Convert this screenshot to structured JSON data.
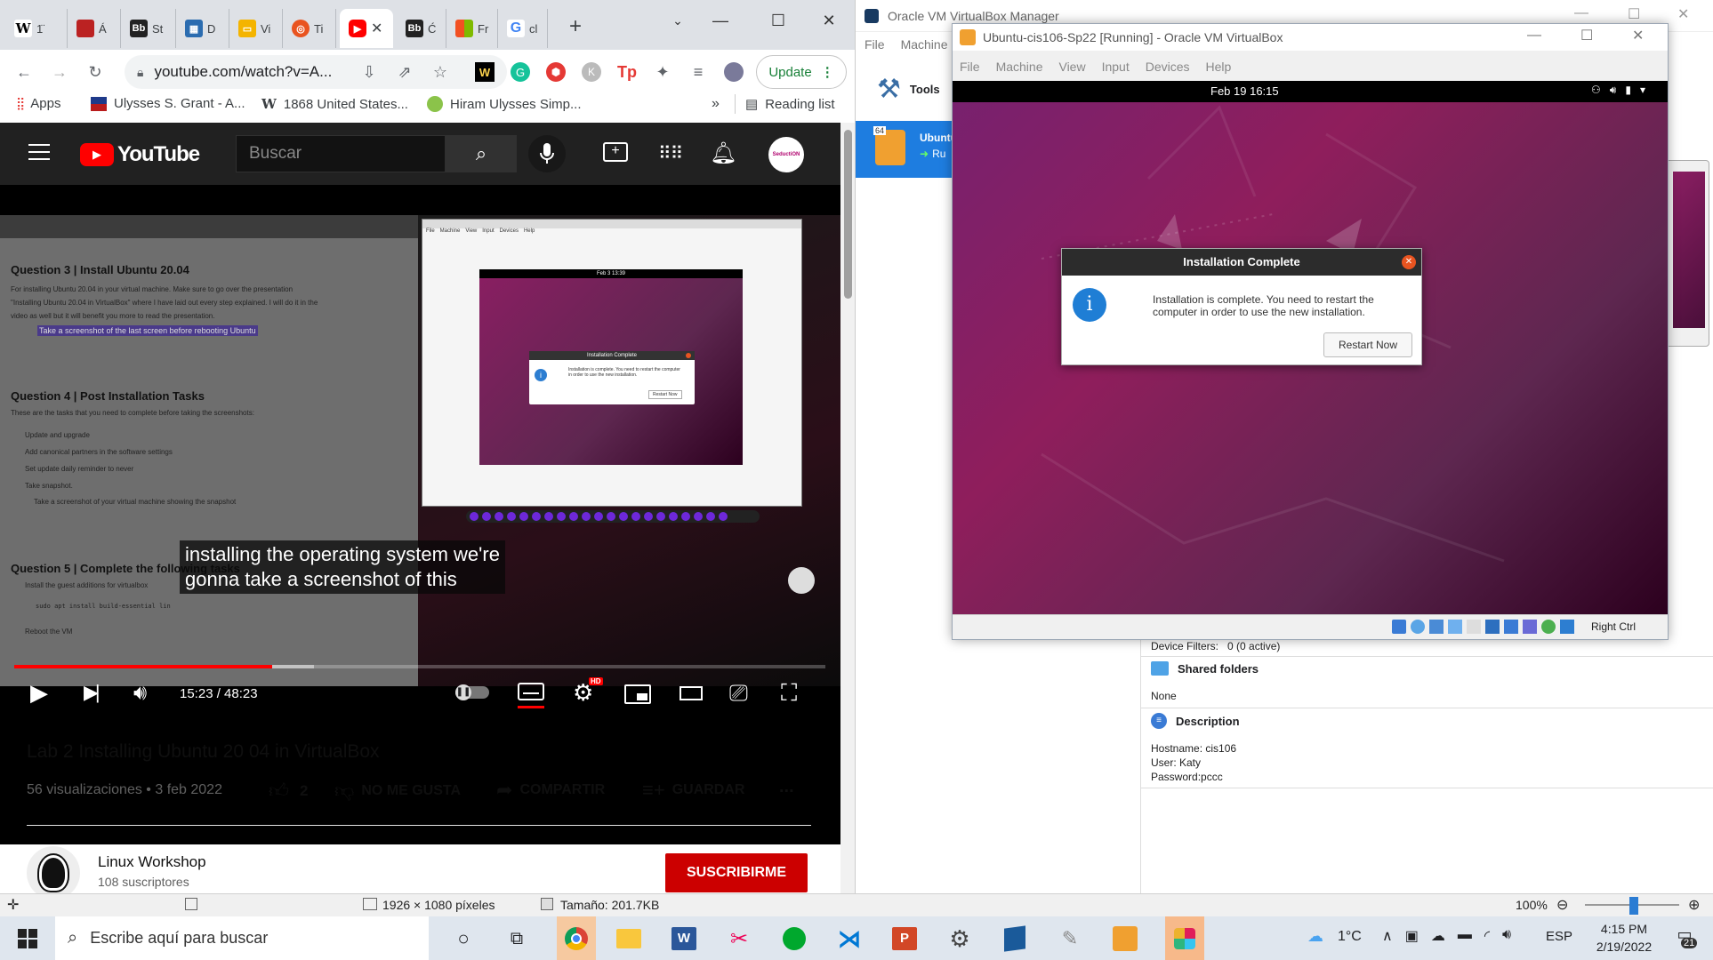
{
  "chrome": {
    "tabs": [
      {
        "label": "1̈",
        "favicon": "W"
      },
      {
        "label": "Á",
        "favicon": "red-square"
      },
      {
        "label": "St",
        "favicon": "Bb"
      },
      {
        "label": "D",
        "favicon": "chart"
      },
      {
        "label": "Vi",
        "favicon": "slides"
      },
      {
        "label": "Ti",
        "favicon": "ubuntu"
      },
      {
        "label": "",
        "favicon": "youtube"
      },
      {
        "label": "Ć",
        "favicon": "Bb"
      },
      {
        "label": "Fr",
        "favicon": "windows"
      },
      {
        "label": "cl",
        "favicon": "google"
      }
    ],
    "url": "youtube.com/watch?v=A...",
    "update_label": "Update",
    "bookmarks": [
      {
        "label": "Apps",
        "icon": "apps-grid-icon"
      },
      {
        "label": "Ulysses S. Grant - A...",
        "icon": "bookmark-flag-icon"
      },
      {
        "label": "1868 United States...",
        "icon": "wikipedia-icon"
      },
      {
        "label": "Hiram Ulysses Simp...",
        "icon": "bookmark-leaf-icon"
      }
    ],
    "reading_list": "Reading list",
    "bookmarks_overflow": "»"
  },
  "youtube": {
    "logo": "YouTube",
    "search_placeholder": "Buscar",
    "avatar_text": "SeductiON",
    "caption_line1": "installing the operating system we're",
    "caption_line2": "gonna take a screenshot of this",
    "time": "15:23 / 48:23",
    "progress": 0.318,
    "buffered": 0.37,
    "hd_badge": "HD",
    "video_title": "Lab 2 Installing Ubuntu 20 04 in VirtualBox",
    "views": "56 visualizaciones • 3 feb 2022",
    "likes": "2",
    "dislike_label": "NO ME GUSTA",
    "share_label": "COMPARTIR",
    "save_label": "GUARDAR",
    "more_label": "...",
    "channel_name": "Linux Workshop",
    "subscribers": "108 suscriptores",
    "subscribe_label": "SUSCRIBIRME",
    "doc": {
      "q3_title": "Question 3 | Install Ubuntu 20.04",
      "q3_text1": "For installing Ubuntu 20.04 in your virtual machine. Make sure to go over the presentation",
      "q3_text2": "\"Installing Ubuntu 20.04 in VirtualBox\" where I have laid out every step explained. I will do it in the",
      "q3_text3": "video as well but it will benefit you more to read the presentation.",
      "q3_highlight": "Take a screenshot of the last screen before rebooting Ubuntu",
      "q4_title": "Question 4 | Post Installation Tasks",
      "q4_text": "These are the tasks that you need to complete before taking the screenshots:",
      "q4_items": [
        "Update and upgrade",
        "Add canonical partners in the software settings",
        "Set update daily reminder to never",
        "Take snapshot."
      ],
      "q4_shot": "Take a screenshot of your virtual machine showing the snapshot",
      "q5_title": "Question 5 | Complete the following tasks",
      "q5_item": "Install the guest additions for virtualbox",
      "q5_cmd": "sudo apt install build-essential lin",
      "q5_reboot": "Reboot the VM"
    },
    "mini_vm": {
      "menu": [
        "File",
        "Machine",
        "View",
        "Input",
        "Devices",
        "Help"
      ],
      "clock": "Feb 3  13:39",
      "dialog_title": "Installation Complete",
      "dialog_text": "Installation is complete. You need to restart the computer in order to use the new installation.",
      "restart": "Restart Now"
    }
  },
  "vbox_manager": {
    "title": "Oracle VM VirtualBox Manager",
    "menu": [
      "File",
      "Machine"
    ],
    "tools_label": "Tools",
    "vm_name": "Ubuntu",
    "vm_state": "Ru",
    "vm_badge": "64",
    "device_filters_label": "Device Filters:",
    "device_filters_value": "0 (0 active)",
    "shared_folders_title": "Shared folders",
    "shared_folders_value": "None",
    "description_title": "Description",
    "description_lines": [
      "Hostname: cis106",
      "User: Katy",
      "Password:pccc"
    ]
  },
  "vbox_vm": {
    "title": "Ubuntu-cis106-Sp22 [Running] - Oracle VM VirtualBox",
    "menu": [
      "File",
      "Machine",
      "View",
      "Input",
      "Devices",
      "Help"
    ],
    "clock": "Feb 19  16:15",
    "dialog_title": "Installation Complete",
    "dialog_text_line1": "Installation is complete. You need to restart the",
    "dialog_text_line2": "computer in order to use the new installation.",
    "restart_label": "Restart Now",
    "host_key": "Right Ctrl"
  },
  "paint_status": {
    "dimensions": "1926 × 1080 píxeles",
    "size": "Tamaño: 201.7KB",
    "zoom": "100%"
  },
  "taskbar": {
    "search_placeholder": "Escribe aquí para buscar",
    "temperature": "1°C",
    "language": "ESP",
    "time": "4:15 PM",
    "date": "2/19/2022",
    "notifications": "21"
  },
  "colors": {
    "youtube_red": "#ff0000",
    "subscribe_red": "#cc0000",
    "ubuntu_purple": "#77216f",
    "dialog_close": "#e95420",
    "update_green": "#188038"
  }
}
